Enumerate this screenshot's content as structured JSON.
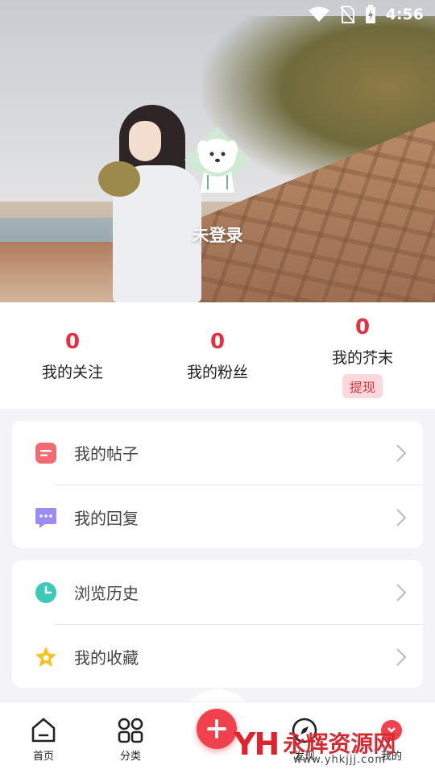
{
  "status_bar": {
    "time": "4:56"
  },
  "profile": {
    "login_status": "未登录"
  },
  "stats": [
    {
      "value": "0",
      "label": "我的关注"
    },
    {
      "value": "0",
      "label": "我的粉丝"
    },
    {
      "value": "0",
      "label": "我的芥末",
      "badge": "提现"
    }
  ],
  "menu_groups": [
    [
      {
        "label": "我的帖子",
        "icon": "post-icon"
      },
      {
        "label": "我的回复",
        "icon": "reply-icon"
      }
    ],
    [
      {
        "label": "浏览历史",
        "icon": "history-icon"
      },
      {
        "label": "我的收藏",
        "icon": "favorite-star-icon"
      }
    ]
  ],
  "bottom_nav": [
    {
      "label": "首页",
      "icon": "home-icon"
    },
    {
      "label": "分类",
      "icon": "category-grid-icon"
    },
    {
      "label": "",
      "icon": "add-plus-icon"
    },
    {
      "label": "发现",
      "icon": "discover-compass-icon"
    },
    {
      "label": "我的",
      "icon": "profile-icon"
    }
  ],
  "watermark": {
    "logo": "YH",
    "title": "永辉资源网",
    "url": "www.yhkjjj.com"
  },
  "colors": {
    "accent": "#e6303f",
    "badge_bg": "#fbd8dc",
    "background": "#f4f4f6"
  }
}
